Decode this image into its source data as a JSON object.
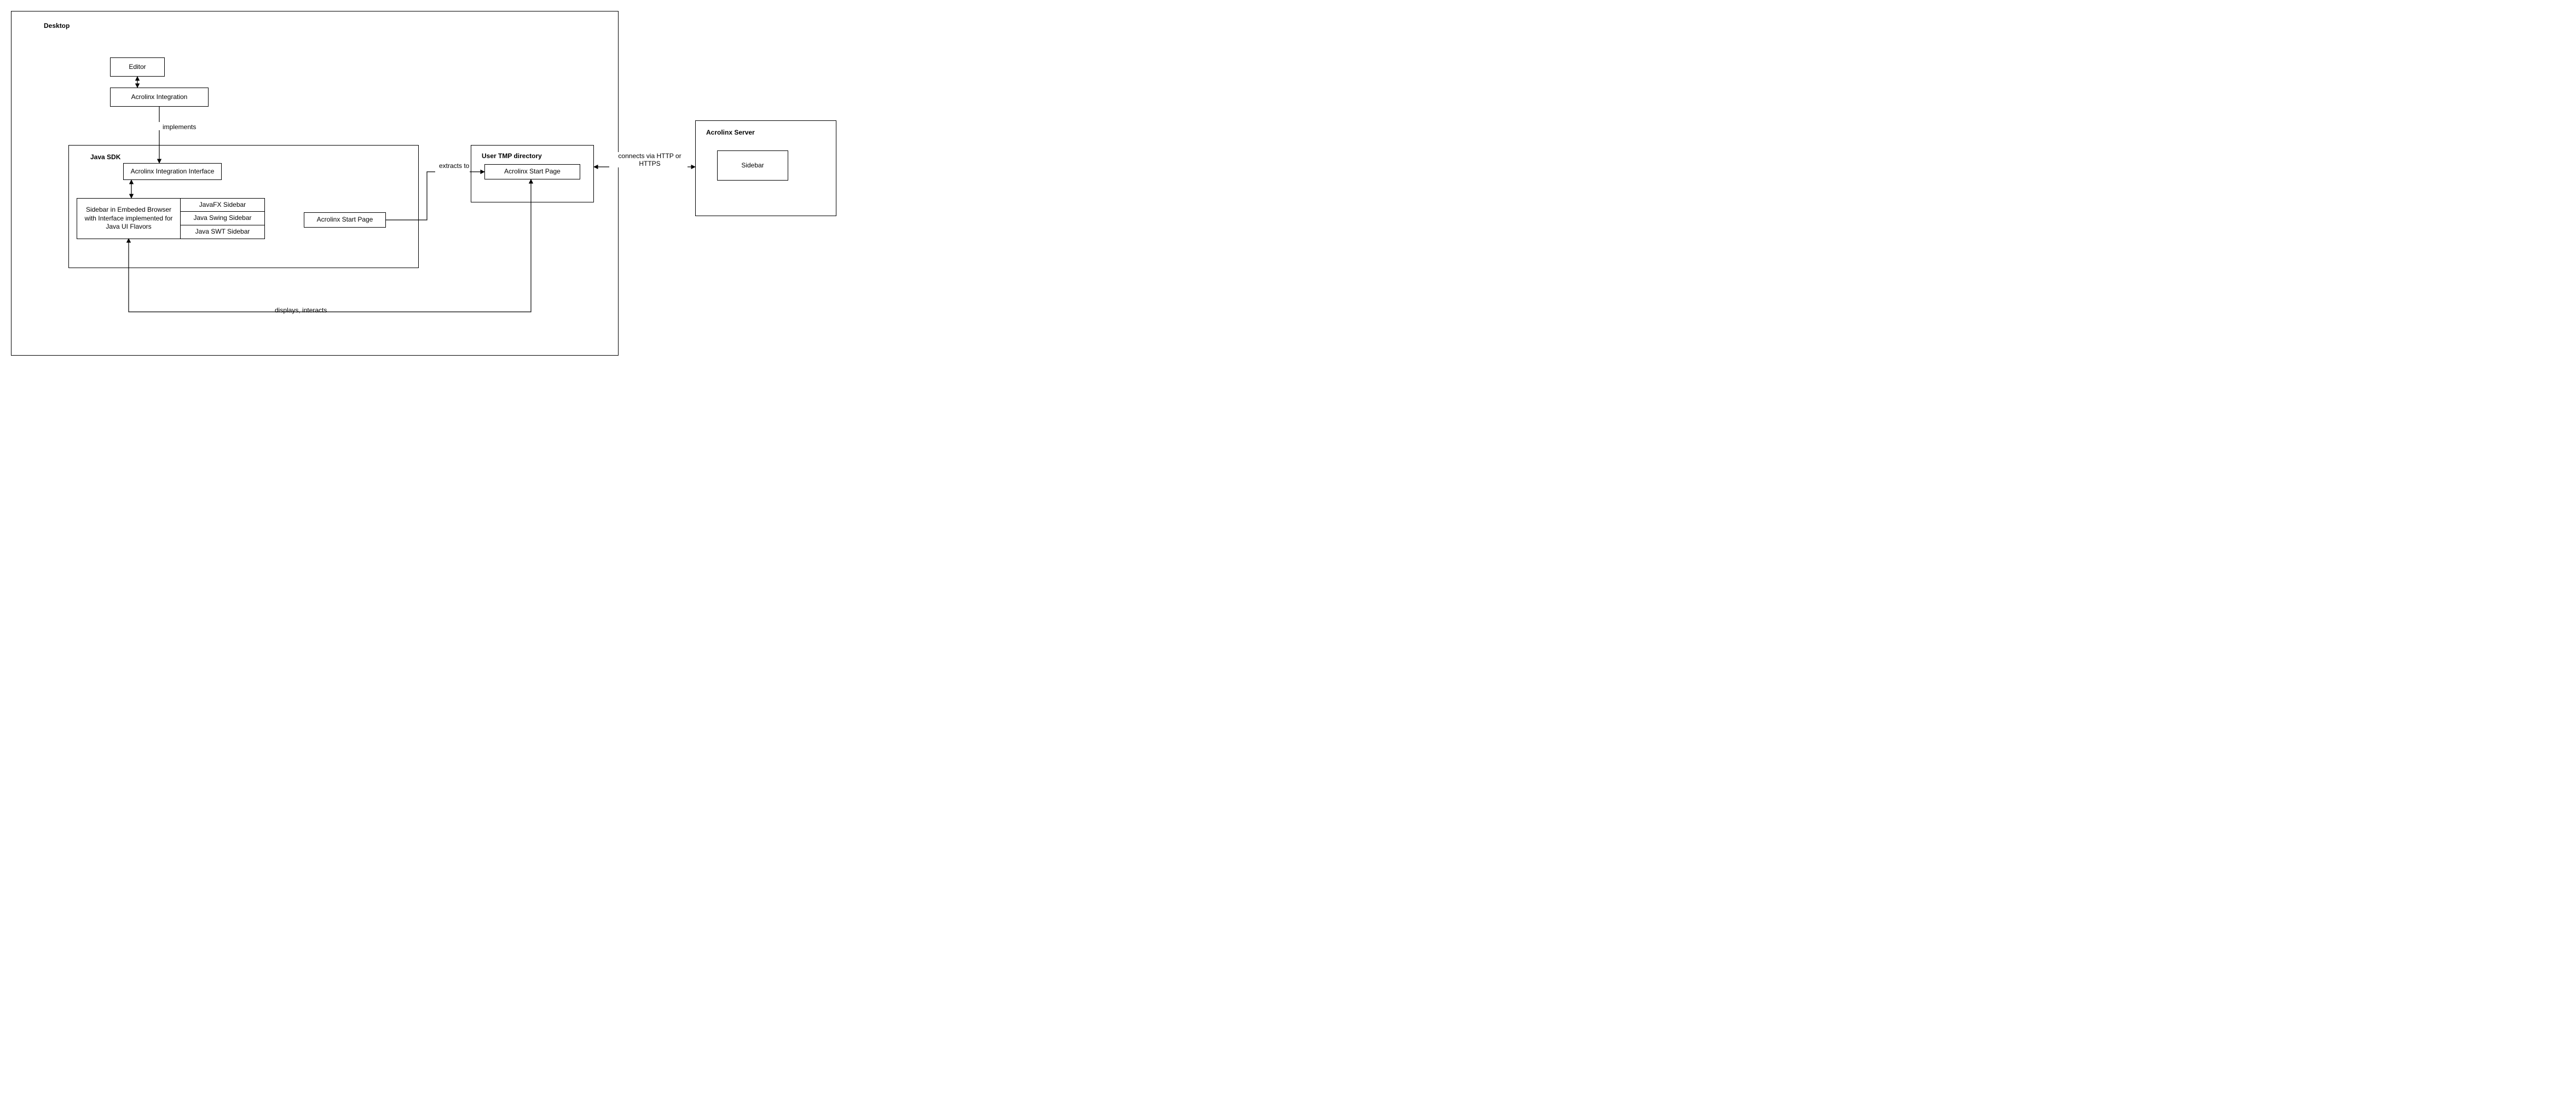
{
  "containers": {
    "desktop": {
      "title": "Desktop"
    },
    "javaSdk": {
      "title": "Java SDK"
    },
    "userTmp": {
      "title": "User TMP directory"
    },
    "acrolinxServer": {
      "title": "Acrolinx Server"
    }
  },
  "nodes": {
    "editor": "Editor",
    "acrolinxIntegration": "Acrolinx Integration",
    "aii": "Acrolinx Integration Interface",
    "sidebarEmbedded": "Sidebar in Embeded Browser with Interface implemented for Java UI Flavors",
    "javafxSidebar": "JavaFX Sidebar",
    "javaSwingSidebar": "Java Swing Sidebar",
    "javaSwtSidebar": "Java SWT Sidebar",
    "startPageSdk": "Acrolinx Start Page",
    "startPageTmp": "Acrolinx Start Page",
    "sidebarServer": "Sidebar"
  },
  "edges": {
    "implements": "implements",
    "extractsTo": "extracts to",
    "displaysInteracts": "displays, interacts",
    "connectsHttp": "connects via HTTP or HTTPS"
  }
}
